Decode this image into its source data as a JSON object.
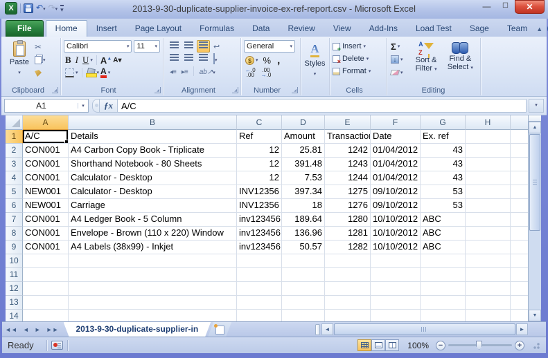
{
  "window": {
    "title": "2013-9-30-duplicate-supplier-invoice-ex-ref-report.csv - Microsoft Excel"
  },
  "ribbon": {
    "active_tab": "Home",
    "tabs": [
      "File",
      "Home",
      "Insert",
      "Page Layout",
      "Formulas",
      "Data",
      "Review",
      "View",
      "Add-Ins",
      "Load Test",
      "Sage",
      "Team"
    ],
    "clipboard": {
      "label": "Clipboard",
      "paste": "Paste"
    },
    "font": {
      "label": "Font",
      "family": "Calibri",
      "size": "11",
      "bold": "B",
      "italic": "I",
      "underline": "U",
      "grow": "A",
      "shrink": "A"
    },
    "alignment": {
      "label": "Alignment"
    },
    "number": {
      "label": "Number",
      "format": "General",
      "percent": "%",
      "comma": ",",
      "inc_decimal": ".0 .00",
      "dec_decimal": ".00 .0"
    },
    "styles": {
      "label": "Styles"
    },
    "cells": {
      "label": "Cells",
      "insert": "Insert",
      "delete": "Delete",
      "format": "Format"
    },
    "editing": {
      "label": "Editing",
      "autosum": "Σ",
      "sort_filter_1": "Sort &",
      "sort_filter_2": "Filter",
      "find_select_1": "Find &",
      "find_select_2": "Select"
    }
  },
  "formula_bar": {
    "name_box": "A1",
    "value": "A/C"
  },
  "sheet": {
    "selected_cell": "A1",
    "columns": [
      "A",
      "B",
      "C",
      "D",
      "E",
      "F",
      "G",
      "H"
    ],
    "header_row": [
      "A/C",
      "Details",
      "Ref",
      "Amount",
      "Transaction",
      "Date",
      "Ex. ref"
    ],
    "rows": [
      [
        "CON001",
        "A4 Carbon Copy Book - Triplicate",
        "12",
        "25.81",
        "1242",
        "01/04/2012",
        "43"
      ],
      [
        "CON001",
        "Shorthand Notebook - 80 Sheets",
        "12",
        "391.48",
        "1243",
        "01/04/2012",
        "43"
      ],
      [
        "CON001",
        "Calculator - Desktop",
        "12",
        "7.53",
        "1244",
        "01/04/2012",
        "43"
      ],
      [
        "NEW001",
        "Calculator - Desktop",
        "INV12356",
        "397.34",
        "1275",
        "09/10/2012",
        "53"
      ],
      [
        "NEW001",
        "Carriage",
        "INV12356",
        "18",
        "1276",
        "09/10/2012",
        "53"
      ],
      [
        "CON001",
        "A4 Ledger Book - 5 Column",
        "inv123456",
        "189.64",
        "1280",
        "10/10/2012",
        "ABC"
      ],
      [
        "CON001",
        "Envelope - Brown (110 x 220) Window",
        "inv123456",
        "136.96",
        "1281",
        "10/10/2012",
        "ABC"
      ],
      [
        "CON001",
        "A4 Labels (38x99) - Inkjet",
        "inv123456",
        "50.57",
        "1282",
        "10/10/2012",
        "ABC"
      ]
    ],
    "visible_row_count": 14,
    "tab_name": "2013-9-30-duplicate-supplier-in"
  },
  "status_bar": {
    "mode": "Ready",
    "zoom_level": "100%"
  },
  "colors": {
    "file_tab_green": "#2a8340",
    "selection_header_orange": "#f9c35c",
    "close_button_red": "#c03322",
    "title_bar_blue": "#b3c3e8"
  }
}
